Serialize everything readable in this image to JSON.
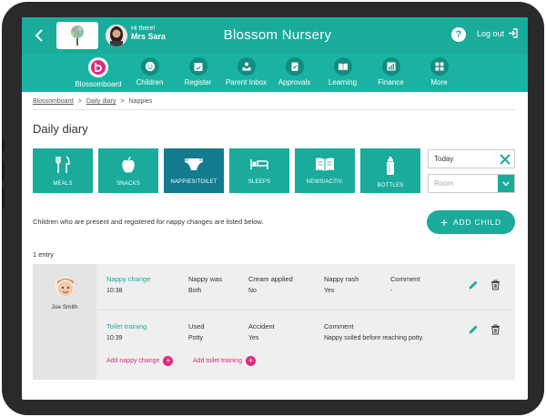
{
  "header": {
    "greeting": "Hi there!",
    "user_name": "Mrs Sara",
    "app_title": "Blossom Nursery",
    "help_label": "?",
    "logout_label": "Log out"
  },
  "nav": {
    "items": [
      {
        "label": "Blossomboard",
        "icon": "blossom-logo-icon"
      },
      {
        "label": "Children",
        "icon": "smiley-icon"
      },
      {
        "label": "Register",
        "icon": "register-icon"
      },
      {
        "label": "Parent Inbox",
        "icon": "inbox-icon"
      },
      {
        "label": "Approvals",
        "icon": "approvals-icon"
      },
      {
        "label": "Learning",
        "icon": "book-icon"
      },
      {
        "label": "Finance",
        "icon": "finance-chart-icon"
      },
      {
        "label": "More",
        "icon": "grid-icon"
      }
    ]
  },
  "breadcrumb": {
    "items": [
      "Blossomboard",
      "Daily diary",
      "Nappies"
    ],
    "separator": ">"
  },
  "page_title": "Daily diary",
  "categories": [
    {
      "label": "MEALS",
      "icon": "fork-knife-icon"
    },
    {
      "label": "SNACKS",
      "icon": "apple-icon"
    },
    {
      "label": "NAPPIES/TOILET",
      "icon": "nappy-icon"
    },
    {
      "label": "SLEEPS",
      "icon": "bed-icon"
    },
    {
      "label": "NEWS/ACTIV.",
      "icon": "open-book-icon"
    },
    {
      "label": "BOTTLES",
      "icon": "bottle-icon"
    }
  ],
  "filters": {
    "date_value": "Today",
    "room_placeholder": "Room"
  },
  "info_text": "Children who are present and registered for nappy changes are listed below.",
  "add_child_label": "ADD CHILD",
  "entry_count": "1 entry",
  "entry": {
    "child_name": "Joe Smith",
    "nappy_change": {
      "title": "Nappy change",
      "time": "10:38",
      "nappy_was_label": "Nappy was",
      "nappy_was_value": "Both",
      "cream_label": "Cream applied",
      "cream_value": "No",
      "rash_label": "Nappy rash",
      "rash_value": "Yes",
      "comment_label": "Comment",
      "comment_value": "-"
    },
    "toilet_training": {
      "title": "Toilet training",
      "time": "10:39",
      "used_label": "Used",
      "used_value": "Potty",
      "accident_label": "Accident",
      "accident_value": "Yes",
      "comment_label": "Comment",
      "comment_value": "Nappy soiled before reaching potty."
    },
    "add_nappy_label": "Add nappy change",
    "add_toilet_label": "Add toilet training"
  },
  "colors": {
    "primary": "#1aab9b",
    "active_tile": "#137b8e",
    "accent_pink": "#e0287d"
  }
}
